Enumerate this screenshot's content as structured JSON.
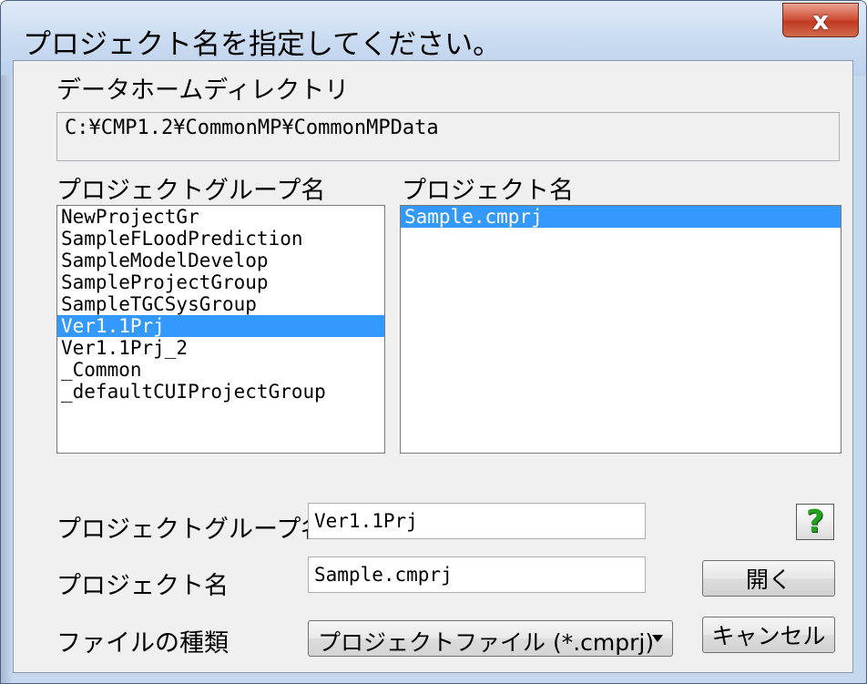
{
  "window": {
    "title": "プロジェクト名を指定してください。",
    "close_label": "x"
  },
  "data_home": {
    "label": "データホームディレクトリ",
    "path": "C:¥CMP1.2¥CommonMP¥CommonMPData"
  },
  "group_list": {
    "header": "プロジェクトグループ名",
    "items": [
      "NewProjectGr",
      "SampleFLoodPrediction",
      "SampleModelDevelop",
      "SampleProjectGroup",
      "SampleTGCSysGroup",
      "Ver1.1Prj",
      "Ver1.1Prj_2",
      "_Common",
      "_defaultCUIProjectGroup"
    ],
    "selected_index": 5
  },
  "project_list": {
    "header": "プロジェクト名",
    "items": [
      "Sample.cmprj"
    ],
    "selected_index": 0
  },
  "form": {
    "group_label": "プロジェクトグループ名",
    "group_value": "Ver1.1Prj",
    "project_label": "プロジェクト名",
    "project_value": "Sample.cmprj",
    "filetype_label": "ファイルの種類",
    "filetype_value": "プロジェクトファイル (*.cmprj)"
  },
  "buttons": {
    "help_label": "?",
    "open_label": "開く",
    "cancel_label": "キャンセル"
  },
  "colors": {
    "selection": "#3399ff",
    "help_icon": "#21a11e",
    "close_button": "#c23a22"
  }
}
